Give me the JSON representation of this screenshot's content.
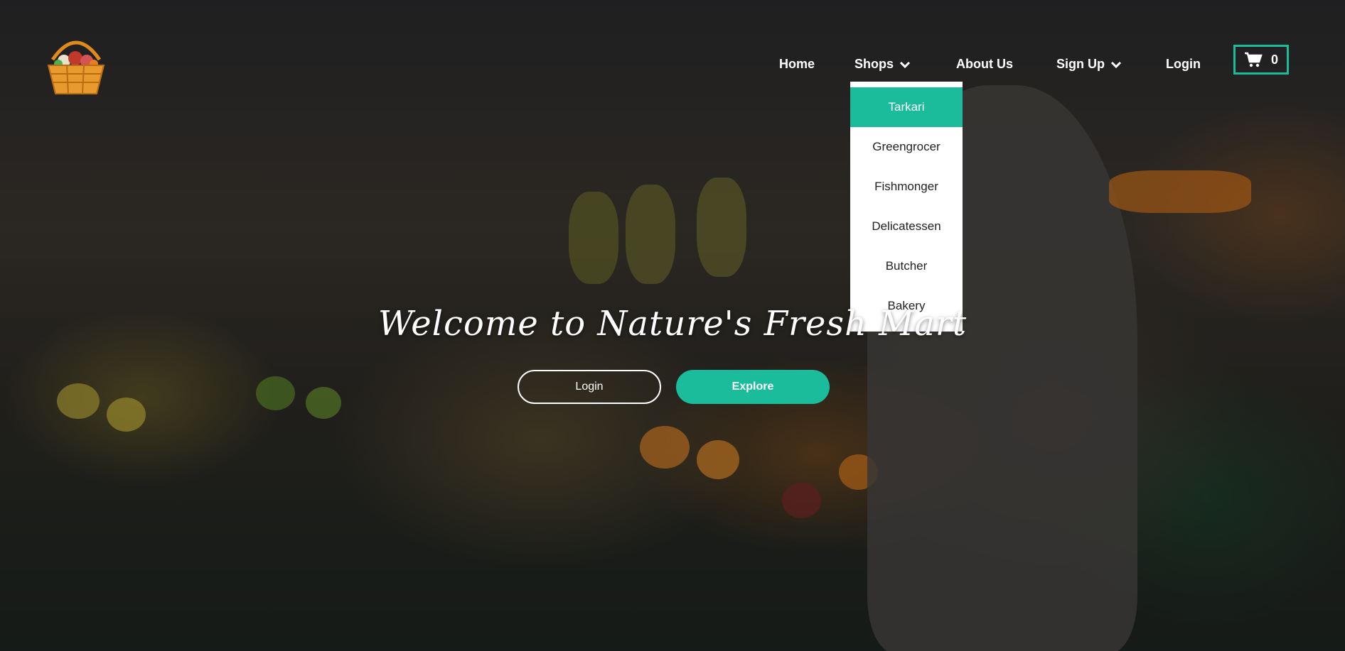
{
  "brand": {
    "logo_icon": "fruit-basket-icon",
    "accent_color": "#1abc9c"
  },
  "nav": {
    "home": "Home",
    "shops": "Shops",
    "about": "About Us",
    "signup": "Sign Up",
    "login": "Login"
  },
  "cart": {
    "icon": "shopping-cart-icon",
    "count": "0"
  },
  "shops_menu": {
    "items": [
      "Tarkari",
      "Greengrocer",
      "Fishmonger",
      "Delicatessen",
      "Butcher",
      "Bakery"
    ],
    "active": "Tarkari"
  },
  "hero": {
    "title": "Welcome to Nature's Fresh Mart",
    "login_button": "Login",
    "explore_button": "Explore"
  }
}
